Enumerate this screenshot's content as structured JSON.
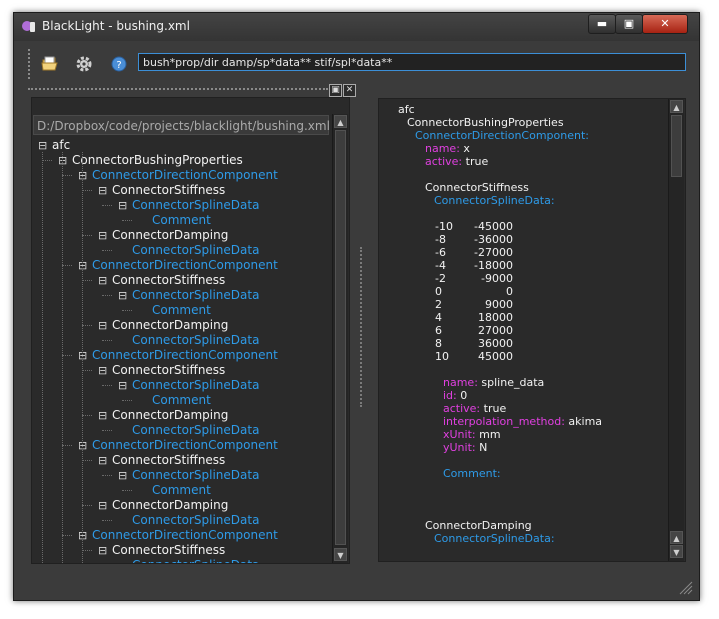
{
  "window": {
    "title": "BlackLight - bushing.xml",
    "buttons": {
      "minimize": "▬",
      "maximize": "▣",
      "close": "✕"
    }
  },
  "toolbar": {
    "icons": [
      "open-folder-icon",
      "gear-icon",
      "help-icon"
    ],
    "search_value": "bush*prop/dir damp/sp*data** stif/spl*data**"
  },
  "dock": {
    "float_label": "▣",
    "close_label": "✕"
  },
  "left_panel": {
    "path": "D:/Dropbox/code/projects/blacklight/bushing.xml",
    "tree": [
      {
        "label": "afc",
        "depth": 0,
        "color": "white",
        "expander": "⊟"
      },
      {
        "label": "ConnectorBushingProperties",
        "depth": 1,
        "color": "white",
        "expander": "⊟"
      },
      {
        "label": "ConnectorDirectionComponent",
        "depth": 2,
        "color": "blue",
        "expander": "⊟"
      },
      {
        "label": "ConnectorStiffness",
        "depth": 3,
        "color": "white",
        "expander": "⊟"
      },
      {
        "label": "ConnectorSplineData",
        "depth": 4,
        "color": "blue",
        "expander": "⊟"
      },
      {
        "label": "Comment",
        "depth": 5,
        "color": "blue",
        "expander": ""
      },
      {
        "label": "ConnectorDamping",
        "depth": 3,
        "color": "white",
        "expander": "⊟"
      },
      {
        "label": "ConnectorSplineData",
        "depth": 4,
        "color": "blue",
        "expander": ""
      },
      {
        "label": "ConnectorDirectionComponent",
        "depth": 2,
        "color": "blue",
        "expander": "⊟"
      },
      {
        "label": "ConnectorStiffness",
        "depth": 3,
        "color": "white",
        "expander": "⊟"
      },
      {
        "label": "ConnectorSplineData",
        "depth": 4,
        "color": "blue",
        "expander": "⊟"
      },
      {
        "label": "Comment",
        "depth": 5,
        "color": "blue",
        "expander": ""
      },
      {
        "label": "ConnectorDamping",
        "depth": 3,
        "color": "white",
        "expander": "⊟"
      },
      {
        "label": "ConnectorSplineData",
        "depth": 4,
        "color": "blue",
        "expander": ""
      },
      {
        "label": "ConnectorDirectionComponent",
        "depth": 2,
        "color": "blue",
        "expander": "⊟"
      },
      {
        "label": "ConnectorStiffness",
        "depth": 3,
        "color": "white",
        "expander": "⊟"
      },
      {
        "label": "ConnectorSplineData",
        "depth": 4,
        "color": "blue",
        "expander": "⊟"
      },
      {
        "label": "Comment",
        "depth": 5,
        "color": "blue",
        "expander": ""
      },
      {
        "label": "ConnectorDamping",
        "depth": 3,
        "color": "white",
        "expander": "⊟"
      },
      {
        "label": "ConnectorSplineData",
        "depth": 4,
        "color": "blue",
        "expander": ""
      },
      {
        "label": "ConnectorDirectionComponent",
        "depth": 2,
        "color": "blue",
        "expander": "⊟"
      },
      {
        "label": "ConnectorStiffness",
        "depth": 3,
        "color": "white",
        "expander": "⊟"
      },
      {
        "label": "ConnectorSplineData",
        "depth": 4,
        "color": "blue",
        "expander": "⊟"
      },
      {
        "label": "Comment",
        "depth": 5,
        "color": "blue",
        "expander": ""
      },
      {
        "label": "ConnectorDamping",
        "depth": 3,
        "color": "white",
        "expander": "⊟"
      },
      {
        "label": "ConnectorSplineData",
        "depth": 4,
        "color": "blue",
        "expander": ""
      },
      {
        "label": "ConnectorDirectionComponent",
        "depth": 2,
        "color": "blue",
        "expander": "⊟"
      },
      {
        "label": "ConnectorStiffness",
        "depth": 3,
        "color": "white",
        "expander": "⊟"
      },
      {
        "label": "ConnectorSplineData",
        "depth": 4,
        "color": "blue",
        "expander": ""
      }
    ]
  },
  "right_panel": {
    "root": "afc",
    "properties": "ConnectorBushingProperties",
    "direction": "ConnectorDirectionComponent:",
    "name_key": "name:",
    "name_val": "x",
    "active_key": "active:",
    "active_val": "true",
    "stiffness": "ConnectorStiffness",
    "spline": "ConnectorSplineData:",
    "table": [
      [
        "-10",
        "-45000"
      ],
      [
        "-8",
        "-36000"
      ],
      [
        "-6",
        "-27000"
      ],
      [
        "-4",
        "-18000"
      ],
      [
        "-2",
        "-9000"
      ],
      [
        "0",
        "0"
      ],
      [
        "2",
        "9000"
      ],
      [
        "4",
        "18000"
      ],
      [
        "6",
        "27000"
      ],
      [
        "8",
        "36000"
      ],
      [
        "10",
        "45000"
      ]
    ],
    "spline_name_key": "name:",
    "spline_name_val": "spline_data",
    "id_key": "id:",
    "id_val": "0",
    "spline_active_key": "active:",
    "spline_active_val": "true",
    "interp_key": "interpolation_method:",
    "interp_val": "akima",
    "xunit_key": "xUnit:",
    "xunit_val": "mm",
    "yunit_key": "yUnit:",
    "yunit_val": "N",
    "comment_key": "Comment:",
    "damping": "ConnectorDamping",
    "damping_spline": "ConnectorSplineData:"
  },
  "colors": {
    "accent": "#3c8fd7",
    "blue_text": "#2e9be8",
    "key_text": "#e040e0",
    "background": "#3b3b3b"
  }
}
